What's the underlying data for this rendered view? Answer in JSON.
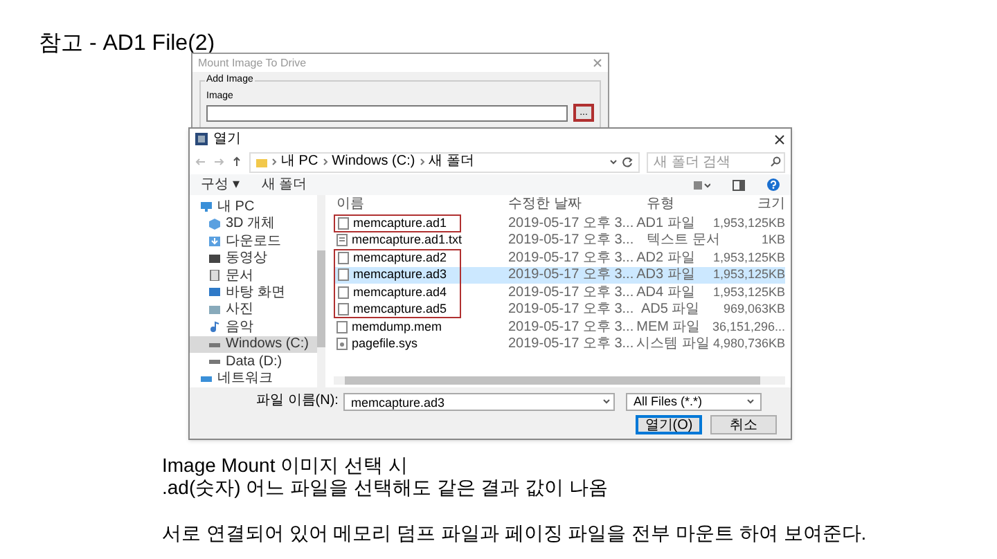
{
  "slide_title": "참고 - AD1 File(2)",
  "mount_window": {
    "title": "Mount Image To Drive",
    "group_label": "Add Image",
    "field_label": "Image",
    "browse_button": {
      "label": "...",
      "highlighted": true
    }
  },
  "open_dialog": {
    "title": "열기",
    "breadcrumb": [
      "내 PC",
      "Windows (C:)",
      "새 폴더"
    ],
    "search": {
      "placeholder": "새 폴더 검색"
    },
    "toolbar": [
      "구성 ▾",
      "새 폴더"
    ],
    "sidebar": [
      {
        "label": "내 PC",
        "kind": "pc",
        "selected": false
      },
      {
        "label": "3D 개체",
        "kind": "cube",
        "selected": false
      },
      {
        "label": "다운로드",
        "kind": "download",
        "selected": false
      },
      {
        "label": "동영상",
        "kind": "video",
        "selected": false
      },
      {
        "label": "문서",
        "kind": "doc",
        "selected": false
      },
      {
        "label": "바탕 화면",
        "kind": "desktop",
        "selected": false
      },
      {
        "label": "사진",
        "kind": "picture",
        "selected": false
      },
      {
        "label": "음악",
        "kind": "music",
        "selected": false
      },
      {
        "label": "Windows (C:)",
        "kind": "drive",
        "selected": true
      },
      {
        "label": "Data (D:)",
        "kind": "drive",
        "selected": false
      },
      {
        "label": "네트워크",
        "kind": "network",
        "selected": false
      }
    ],
    "columns": [
      "이름",
      "수정한 날짜",
      "유형",
      "크기"
    ],
    "files": [
      {
        "name": "memcapture.ad1",
        "date": "2019-05-17 오후 3...",
        "type": "AD1 파일",
        "size": "1,953,125KB",
        "kind": "file",
        "selected": false,
        "highlighted": true
      },
      {
        "name": "memcapture.ad1.txt",
        "date": "2019-05-17 오후 3...",
        "type": "텍스트 문서",
        "size": "1KB",
        "kind": "text",
        "selected": false,
        "highlighted": false
      },
      {
        "name": "memcapture.ad2",
        "date": "2019-05-17 오후 3...",
        "type": "AD2 파일",
        "size": "1,953,125KB",
        "kind": "file",
        "selected": false,
        "highlighted": true
      },
      {
        "name": "memcapture.ad3",
        "date": "2019-05-17 오후 3...",
        "type": "AD3 파일",
        "size": "1,953,125KB",
        "kind": "file",
        "selected": true,
        "highlighted": true
      },
      {
        "name": "memcapture.ad4",
        "date": "2019-05-17 오후 3...",
        "type": "AD4 파일",
        "size": "1,953,125KB",
        "kind": "file",
        "selected": false,
        "highlighted": true
      },
      {
        "name": "memcapture.ad5",
        "date": "2019-05-17 오후 3...",
        "type": "AD5 파일",
        "size": "969,063KB",
        "kind": "file",
        "selected": false,
        "highlighted": true
      },
      {
        "name": "memdump.mem",
        "date": "2019-05-17 오후 3...",
        "type": "MEM 파일",
        "size": "36,151,296...",
        "kind": "file",
        "selected": false,
        "highlighted": false
      },
      {
        "name": "pagefile.sys",
        "date": "2019-05-17 오후 3...",
        "type": "시스템 파일",
        "size": "4,980,736KB",
        "kind": "system",
        "selected": false,
        "highlighted": false
      }
    ],
    "filename_label": "파일 이름(N):",
    "filename_value": "memcapture.ad3",
    "filter": "All Files (*.*)",
    "buttons": [
      "열기(O)",
      "취소"
    ]
  },
  "notes": [
    "Image Mount 이미지 선택 시",
    ".ad(숫자) 어느 파일을 선택해도 같은 결과 값이 나옴",
    "서로 연결되어 있어 메모리 덤프 파일과 페이징 파일을 전부 마운트 하여 보여준다."
  ]
}
